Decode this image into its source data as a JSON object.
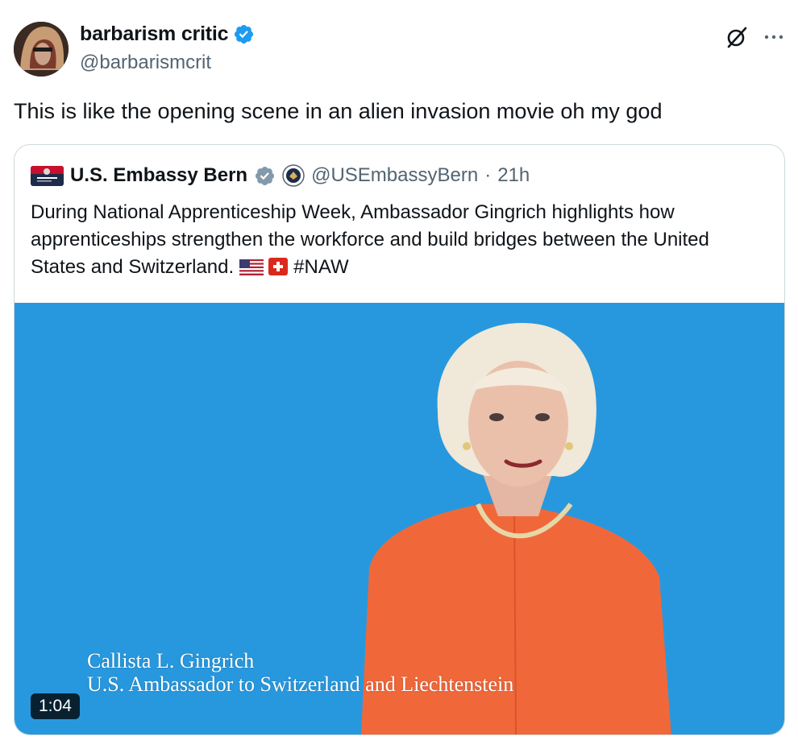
{
  "tweet": {
    "author_name": "barbarism critic",
    "author_handle": "@barbarismcrit",
    "verified": true,
    "text": "This is like the opening scene in an alien invasion movie oh my god",
    "actions": {
      "grok_icon": "grok-icon",
      "more_icon": "more-icon"
    }
  },
  "quote": {
    "author_name": "U.S. Embassy Bern",
    "author_handle": "@USEmbassyBern",
    "separator": "·",
    "time": "21h",
    "text": "During National Apprenticeship Week, Ambassador Gingrich highlights how apprenticeships strengthen the workforce and build bridges between the United States and Switzerland.",
    "hashtag": "#NAW",
    "flags": [
      "us-flag-icon",
      "swiss-flag-icon"
    ],
    "media": {
      "caption_name": "Callista L. Gingrich",
      "caption_title": "U.S. Ambassador to Switzerland and Liechtenstein",
      "duration": "1:04",
      "background_color": "#2898de"
    }
  },
  "colors": {
    "verified_blue": "#1d9bf0",
    "gray_badge": "#829aab",
    "muted": "#536471"
  }
}
